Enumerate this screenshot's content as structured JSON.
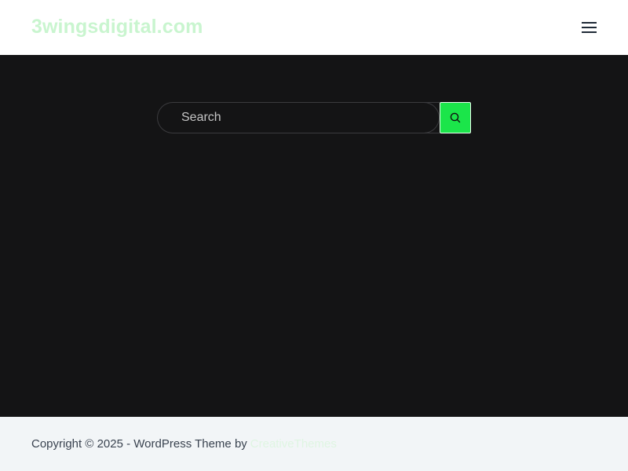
{
  "header": {
    "site_title": "3wingsdigital.com",
    "menu_icon": "hamburger-menu-icon",
    "title_color": "#c9f5cf"
  },
  "search": {
    "placeholder": "Search",
    "value": "",
    "button_icon": "search-icon",
    "button_color": "#1be54a"
  },
  "main": {
    "background_color": "#141415"
  },
  "footer": {
    "copyright_text": "Copyright © 2025 - WordPress Theme by",
    "link_text": "CreativeThemes",
    "background_color": "#f2f5f7"
  }
}
